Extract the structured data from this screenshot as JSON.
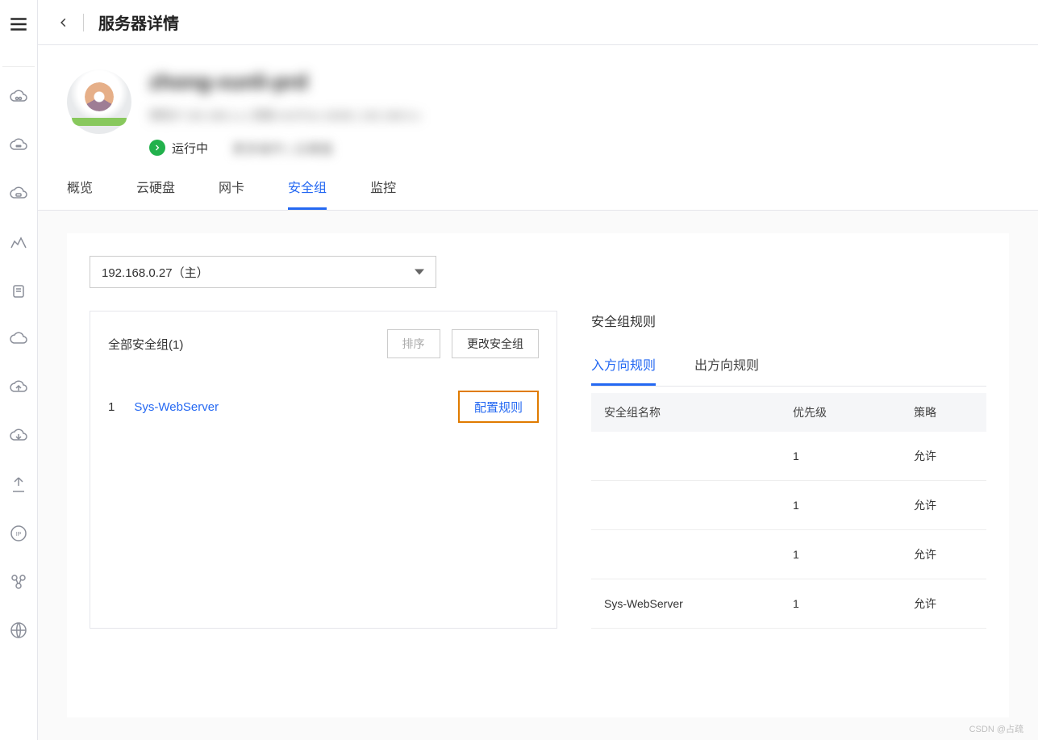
{
  "header": {
    "page_title": "服务器详情"
  },
  "server": {
    "name_blurred": "zhong-xunli-prd",
    "meta_blurred": "弹性IP 192.168.x.x | 规格 4vCPUs 16GB | 192.168.0.x",
    "status": "运行中",
    "status_extra": "更多操作 | 云硬盘"
  },
  "tabs": [
    {
      "label": "概览",
      "active": false
    },
    {
      "label": "云硬盘",
      "active": false
    },
    {
      "label": "网卡",
      "active": false
    },
    {
      "label": "安全组",
      "active": true
    },
    {
      "label": "监控",
      "active": false
    }
  ],
  "ip_select": {
    "value": "192.168.0.27（主）"
  },
  "sg_panel": {
    "all_label": "全部安全组(1)",
    "sort_btn": "排序",
    "change_btn": "更改安全组",
    "items": [
      {
        "idx": "1",
        "name": "Sys-WebServer",
        "config_label": "配置规则"
      }
    ]
  },
  "rules_panel": {
    "title": "安全组规则",
    "tabs": [
      {
        "label": "入方向规则",
        "active": true
      },
      {
        "label": "出方向规则",
        "active": false
      }
    ],
    "columns": {
      "name": "安全组名称",
      "priority": "优先级",
      "policy": "策略"
    },
    "rows": [
      {
        "name": "",
        "priority": "1",
        "policy": "允许"
      },
      {
        "name": "",
        "priority": "1",
        "policy": "允许"
      },
      {
        "name": "",
        "priority": "1",
        "policy": "允许"
      },
      {
        "name": "Sys-WebServer",
        "priority": "1",
        "policy": "允许"
      }
    ]
  },
  "watermark": "CSDN @占疏"
}
